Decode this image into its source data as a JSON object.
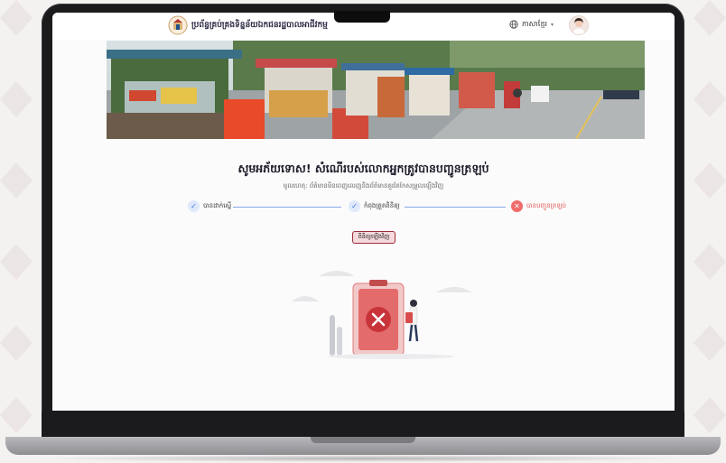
{
  "app": {
    "title": "ប្រព័ន្ធគ្រប់គ្រងទិន្នន័យឯកជនរដ្ឋបាលអាជីវកម្ម",
    "language_label": "ភាសាខ្មែរ"
  },
  "content": {
    "headline": "សូមអភ័យទោស! សំណើរបស់លោកអ្នកត្រូវបានបញ្ជូនត្រឡប់",
    "reason": "មូលហេតុ: ព័ត៌មានមិនពេញលេញនិងព័ត៌មានគួរតែកែសម្រួលឡើងវិញ"
  },
  "stepper": {
    "steps": [
      {
        "label": "បានដាក់ស្នើ",
        "status": "done"
      },
      {
        "label": "កំពុងត្រួតពិនិត្យ",
        "status": "done"
      },
      {
        "label": "បានបញ្ជូនត្រឡប់",
        "status": "failed"
      }
    ]
  },
  "actions": {
    "retry_label": "ពិនិត្យឡើងវិញ"
  },
  "colors": {
    "accent_blue": "#3b6fd8",
    "error_red": "#f06b6b",
    "button_border": "#9b2f3a"
  },
  "icons": {
    "lang": "globe-icon",
    "step_done": "check-icon",
    "step_fail": "close-icon",
    "illustration": "rejected-document-illustration"
  }
}
